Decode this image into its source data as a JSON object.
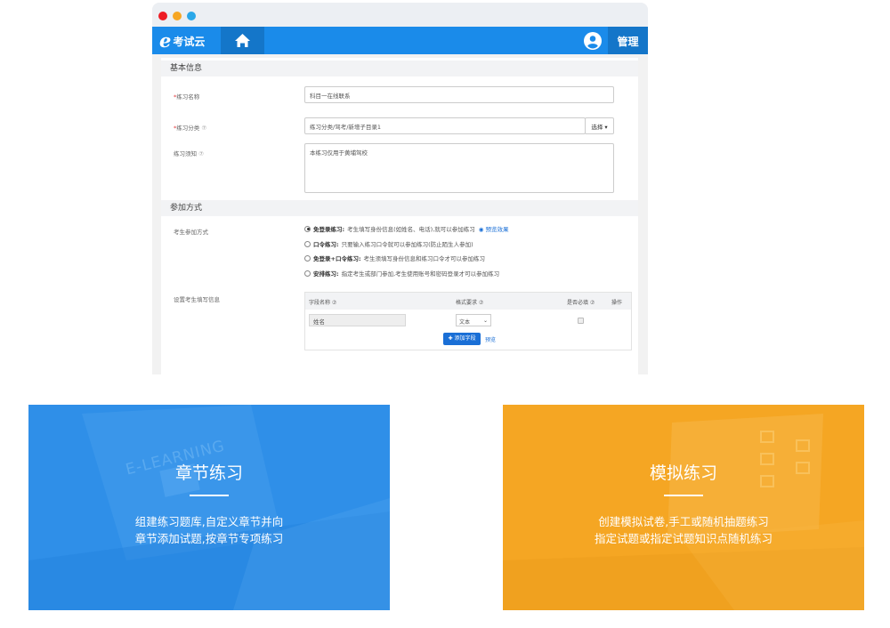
{
  "app": {
    "logo_letter": "e",
    "logo_text": "考试云",
    "admin_label": "管理"
  },
  "form": {
    "basic_section": "基本信息",
    "name_label": "练习名称",
    "name_value": "科目一在线联系",
    "category_label": "练习分类",
    "category_value": "练习分类/驾考/新增子目录1",
    "select_button": "选择",
    "notice_label": "练习须知",
    "notice_value": "本练习仅用于黄埔驾校",
    "join_section": "参加方式",
    "join_label": "考生参加方式",
    "options": [
      {
        "title": "免登录练习:",
        "desc": "考生填写身份信息(如姓名、电话),就可以参加练习",
        "link": "预览效果",
        "selected": true
      },
      {
        "title": "口令练习:",
        "desc": "只要输入练习口令就可以参加练习(防止陌生人参加)",
        "selected": false
      },
      {
        "title": "免登录+口令练习:",
        "desc": "考生须填写身份信息和练习口令才可以参加练习",
        "selected": false
      },
      {
        "title": "安排练习:",
        "desc": "指定考生或部门参加,考生使用账号和密码登录才可以参加练习",
        "selected": false
      }
    ],
    "fill_label": "设置考生填写信息",
    "table": {
      "headers": [
        "字段名称",
        "格式要求",
        "是否必填",
        "操作"
      ],
      "row": {
        "field": "姓名",
        "format": "文本"
      },
      "add_button": "添加字段",
      "preview": "预览"
    }
  },
  "cards": [
    {
      "title": "章节练习",
      "lines": [
        "组建练习题库,自定义章节并向",
        "章节添加试题,按章节专项练习"
      ],
      "bg_text": "E-LEARNING",
      "color": "#2f8fe8"
    },
    {
      "title": "模拟练习",
      "lines": [
        "创建模拟试卷,手工或随机抽题练习",
        "指定试题或指定试题知识点随机练习"
      ],
      "color": "#f5a623"
    }
  ],
  "colors": {
    "primary": "#1a8bea",
    "primary_dark": "#1476c9",
    "blue_card": "#2f8fe8",
    "orange_card": "#f5a623"
  }
}
